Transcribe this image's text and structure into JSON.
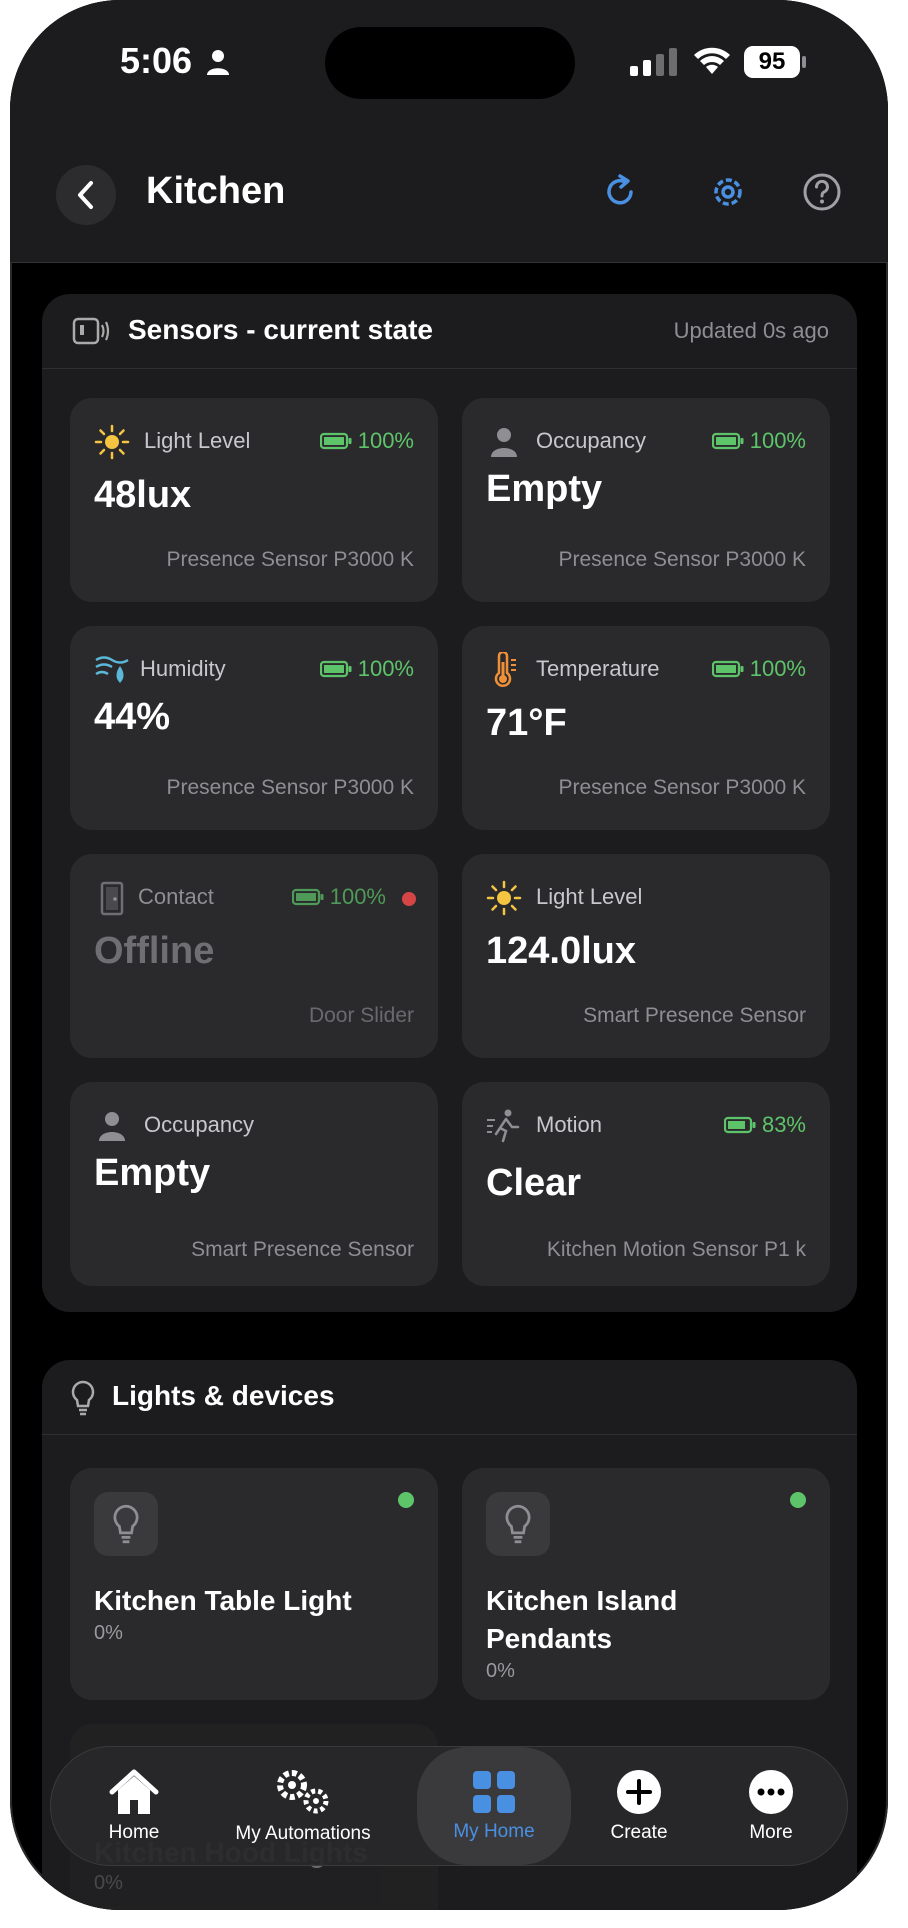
{
  "status": {
    "time": "5:06",
    "battery": "95"
  },
  "header": {
    "title": "Kitchen"
  },
  "sensors": {
    "title": "Sensors - current state",
    "updated": "Updated 0s ago",
    "tiles": [
      {
        "label": "Light Level",
        "value": "48lux",
        "battery": "100%",
        "device": "Presence Sensor P3000 K",
        "icon": "sun-icon"
      },
      {
        "label": "Occupancy",
        "value": "Empty",
        "battery": "100%",
        "device": "Presence Sensor P3000 K",
        "icon": "person-icon"
      },
      {
        "label": "Humidity",
        "value": "44%",
        "battery": "100%",
        "device": "Presence Sensor P3000 K",
        "icon": "humidity-icon"
      },
      {
        "label": "Temperature",
        "value": "71°F",
        "battery": "100%",
        "device": "Presence Sensor P3000 K",
        "icon": "thermometer-icon"
      },
      {
        "label": "Contact",
        "value": "Offline",
        "battery": "100%",
        "device": "Door Slider",
        "icon": "door-icon",
        "offline": true
      },
      {
        "label": "Light Level",
        "value": "124.0lux",
        "battery": "",
        "device": "Smart Presence Sensor",
        "icon": "sun-icon"
      },
      {
        "label": "Occupancy",
        "value": "Empty",
        "battery": "",
        "device": "Smart Presence Sensor",
        "icon": "person-icon"
      },
      {
        "label": "Motion",
        "value": "Clear",
        "battery": "83%",
        "device": "Kitchen Motion Sensor P1 k",
        "icon": "motion-icon"
      }
    ]
  },
  "lights": {
    "title": "Lights & devices",
    "devices": [
      {
        "name": "Kitchen Table Light",
        "level": "0%"
      },
      {
        "name": "Kitchen Island Pendants",
        "level": "0%"
      },
      {
        "name": "Kitchen Hood Lights",
        "level": "0%"
      }
    ]
  },
  "tabs": [
    {
      "label": "Home",
      "icon": "house-icon"
    },
    {
      "label": "My Automations",
      "icon": "gears-icon"
    },
    {
      "label": "My Home",
      "icon": "grid-icon",
      "active": true
    },
    {
      "label": "Create",
      "icon": "plus-icon"
    },
    {
      "label": "More",
      "icon": "ellipsis-icon"
    }
  ],
  "colors": {
    "accent": "#4a90e2",
    "battery_green": "#5ec46a",
    "offline_red": "#d64545"
  }
}
